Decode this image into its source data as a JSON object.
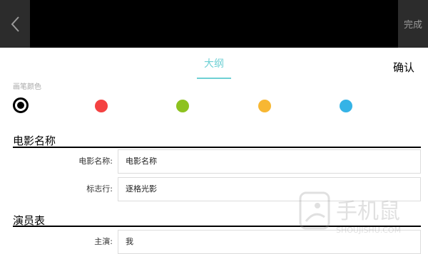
{
  "topbar": {
    "done_label": "完成"
  },
  "tabs": [
    {
      "label": "大纲",
      "active": true
    }
  ],
  "actions": {
    "confirm_label": "确认"
  },
  "brush": {
    "label": "画笔颜色",
    "colors": [
      "#000000",
      "#f44242",
      "#8dc21f",
      "#f7b733",
      "#35b3e6"
    ],
    "selected_index": 0
  },
  "sections": [
    {
      "title": "电影名称",
      "fields": [
        {
          "label": "电影名称:",
          "value": "电影名称"
        },
        {
          "label": "标志行:",
          "value": "逐格光影"
        }
      ]
    },
    {
      "title": "演员表",
      "fields": [
        {
          "label": "主演:",
          "value": "我"
        }
      ]
    }
  ],
  "watermark": {
    "brand": "手机鼠",
    "sub": "SHOUJISHU.COM"
  }
}
